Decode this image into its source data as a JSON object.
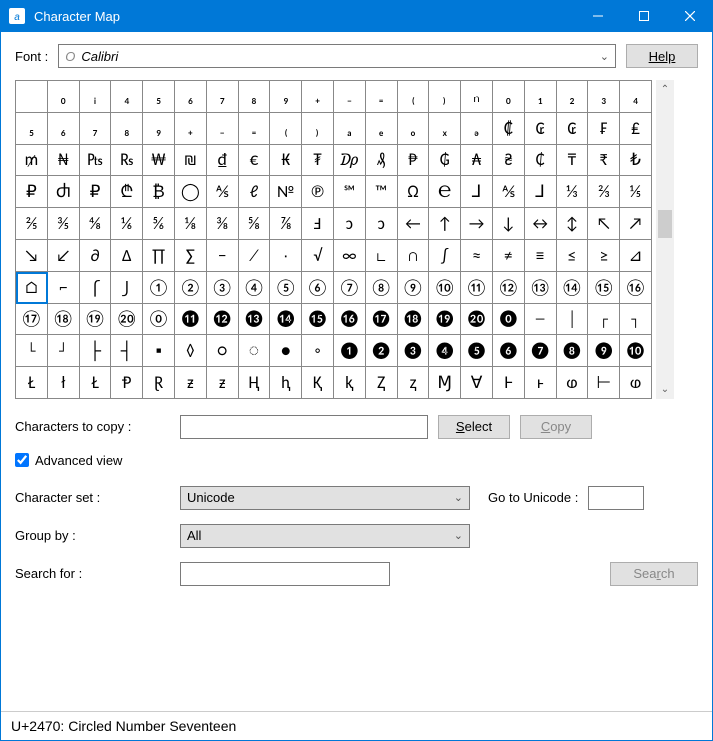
{
  "window": {
    "title": "Character Map"
  },
  "font_row": {
    "label": "Font :",
    "value": "Calibri",
    "help": "Help"
  },
  "grid": {
    "selected_index": 120,
    "cells": [
      "",
      "₀",
      "ᵢ",
      "₄",
      "₅",
      "₆",
      "₇",
      "₈",
      "₉",
      "₊",
      "₋",
      "₌",
      "₍",
      "₎",
      "ₙ",
      "₀",
      "₁",
      "₂",
      "₃",
      "₄",
      "₅",
      "₆",
      "₇",
      "₈",
      "₉",
      "₊",
      "₋",
      "₌",
      "₍",
      "₎",
      "ₐ",
      "ₑ",
      "ₒ",
      "ₓ",
      "ₔ",
      "₡",
      "₢",
      "₢",
      "₣",
      "₤",
      "₥",
      "₦",
      "₧",
      "₨",
      "₩",
      "₪",
      "₫",
      "€",
      "₭",
      "₮",
      "₯",
      "₰",
      "₱",
      "₲",
      "₳",
      "₴",
      "₵",
      "₸",
      "₹",
      "₺",
      "₽",
      "Ⴛ",
      "₽",
      "₾",
      "₿",
      "◯",
      "⅍",
      "ℓ",
      "№",
      "℗",
      "℠",
      "™",
      "Ω",
      "℮",
      "⅃",
      "⅍",
      "⅃",
      "⅓",
      "⅔",
      "⅕",
      "⅖",
      "⅗",
      "⅘",
      "⅙",
      "⅚",
      "⅛",
      "⅜",
      "⅝",
      "⅞",
      "Ⅎ",
      "ↄ",
      "ↄ",
      "←",
      "↑",
      "→",
      "↓",
      "↔",
      "↕",
      "↖",
      "↗",
      "↘",
      "↙",
      "∂",
      "∆",
      "∏",
      "∑",
      "−",
      "∕",
      "∙",
      "√",
      "∞",
      "∟",
      "∩",
      "∫",
      "≈",
      "≠",
      "≡",
      "≤",
      "≥",
      "⊿",
      "⌂",
      "⌐",
      "⌠",
      "⌡",
      "①",
      "②",
      "③",
      "④",
      "⑤",
      "⑥",
      "⑦",
      "⑧",
      "⑨",
      "⑩",
      "⑪",
      "⑫",
      "⑬",
      "⑭",
      "⑮",
      "⑯",
      "⑰",
      "⑱",
      "⑲",
      "⑳",
      "⓪",
      "⓫",
      "⓬",
      "⓭",
      "⓮",
      "⓯",
      "⓰",
      "⓱",
      "⓲",
      "⓳",
      "⓴",
      "⓿",
      "─",
      "│",
      "┌",
      "┐",
      "└",
      "┘",
      "├",
      "┤",
      "▪",
      "◊",
      "○",
      "◌",
      "●",
      "◦",
      "❶",
      "❷",
      "❸",
      "❹",
      "❺",
      "❻",
      "❼",
      "❽",
      "❾",
      "❿",
      "Ł",
      "ł",
      "Ł",
      "Ᵽ",
      "Ɽ",
      "ƶ",
      "ƶ",
      "Ⱨ",
      "ⱨ",
      "Ⱪ",
      "ⱪ",
      "Ⱬ",
      "ⱬ",
      "Ɱ",
      "Ɐ",
      "Ⱶ",
      "ⱶ",
      "ⱷ",
      "⊢",
      "ⱷ"
    ]
  },
  "copy": {
    "label": "Characters to copy :",
    "value": "",
    "select": "Select",
    "copy": "Copy"
  },
  "advanced": {
    "label": "Advanced view",
    "checked": true
  },
  "charset": {
    "label": "Character set :",
    "value": "Unicode",
    "goto_label": "Go to Unicode :",
    "goto_value": ""
  },
  "groupby": {
    "label": "Group by :",
    "value": "All"
  },
  "search": {
    "label": "Search for :",
    "value": "",
    "button": "Search"
  },
  "status": "U+2470: Circled Number Seventeen"
}
